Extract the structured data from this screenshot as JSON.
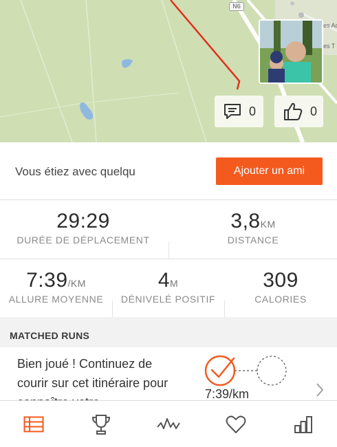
{
  "map": {
    "road_badge": "N6"
  },
  "social": {
    "comments_count": "0",
    "kudos_count": "0"
  },
  "with_whom": {
    "text": "Vous étiez avec quelqu",
    "button_label": "Ajouter un ami"
  },
  "stats": {
    "moving_time": {
      "value": "29:29",
      "unit": "",
      "label": "DURÉE DE DÉPLACEMENT"
    },
    "distance": {
      "value": "3,8",
      "unit": "KM",
      "label": "DISTANCE"
    },
    "pace": {
      "value": "7:39",
      "unit": "/KM",
      "label": "ALLURE MOYENNE"
    },
    "elevation": {
      "value": "4",
      "unit": "M",
      "label": "DÉNIVELÉ POSITIF"
    },
    "calories": {
      "value": "309",
      "unit": "",
      "label": "CALORIES"
    }
  },
  "matched_runs": {
    "header": "MATCHED RUNS",
    "message": "Bien joué ! Continuez de courir sur cet itinéraire pour connaître votre",
    "pace": "7:39/km"
  },
  "nav": {
    "items": [
      "feed-icon",
      "trophy-icon",
      "activity-icon",
      "heart-icon",
      "stats-icon"
    ],
    "active_color": "#f45a1e",
    "inactive_color": "#555555"
  },
  "colors": {
    "brand": "#f45a1e",
    "route": "#e0301e",
    "map_green": "#cfdfb3",
    "water": "#8fb8e0"
  }
}
